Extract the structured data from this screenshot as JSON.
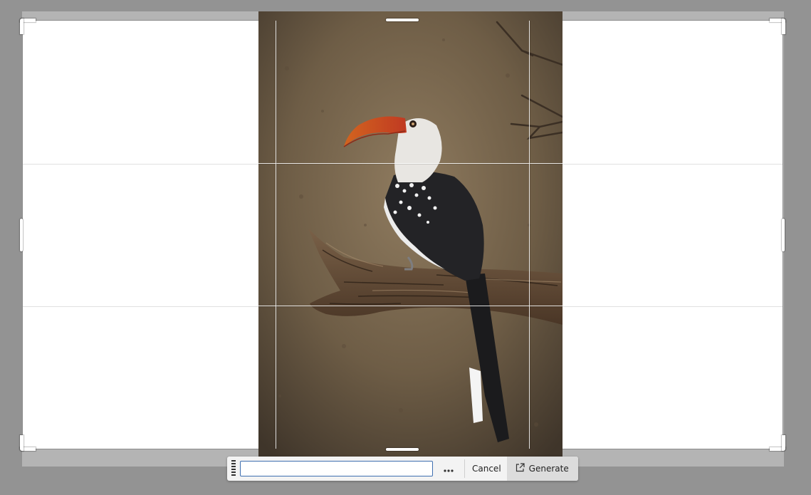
{
  "toolbar": {
    "prompt_value": "",
    "prompt_placeholder": "",
    "more_icon": "ellipsis-icon",
    "cancel_label": "Cancel",
    "generate_label": "Generate",
    "generate_icon": "external-link-icon"
  },
  "crop": {
    "grid": "rule-of-thirds",
    "photo_subject": "hornbill-on-branch"
  },
  "colors": {
    "backdrop": "#939393",
    "crop_fill": "#ffffff",
    "input_border": "#3e6fb0",
    "generate_bg": "#dcdcdc"
  }
}
